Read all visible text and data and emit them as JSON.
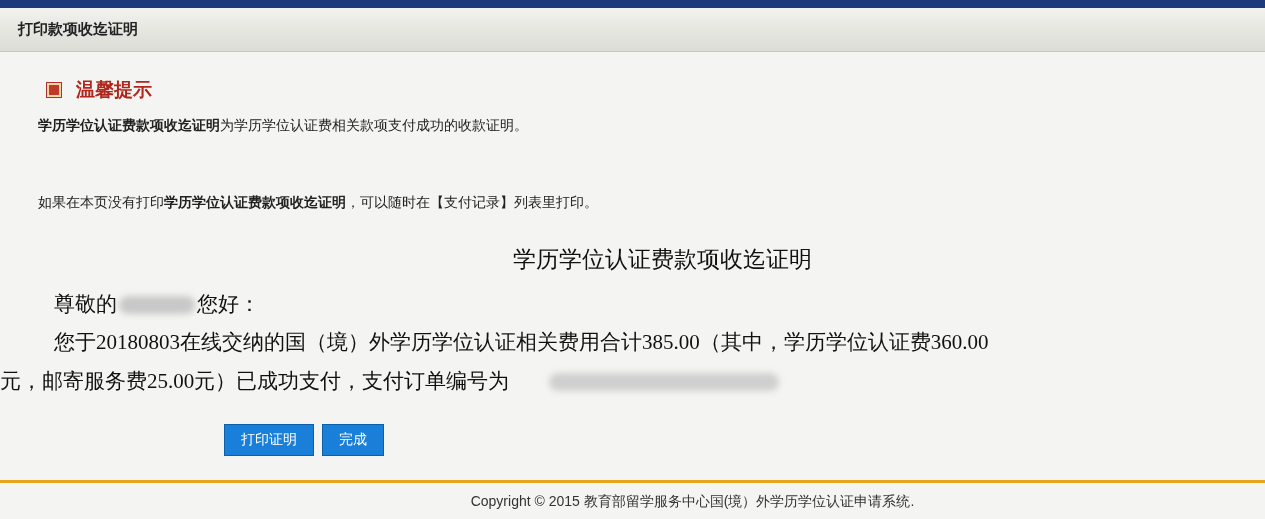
{
  "panel": {
    "title": "打印款项收迄证明"
  },
  "notice": {
    "heading": "温馨提示",
    "lines": [
      "**学历学位认证费款项收迄证明**为学历学位认证费相关款项支付成功的收款证明。",
      "如果在本页没有打印**学历学位认证费款项收迄证明**，可以随时在【支付记录】列表里打印。"
    ]
  },
  "certificate": {
    "title": "学历学位认证费款项收迄证明",
    "greeting_before": "尊敬的",
    "greeting_after": "您好：",
    "body_line_1": "您于20180803在线交纳的国（境）外学历学位认证相关费用合计385.00（其中，学历学位认证费360.00",
    "body_line_2": "元，邮寄服务费25.00元）已成功支付，支付订单编号为"
  },
  "buttons": [
    "打印证明",
    "完成"
  ],
  "footer": {
    "copyright": "Copyright © 2015 教育部留学服务中心国(境）外学历学位认证申请系统."
  }
}
